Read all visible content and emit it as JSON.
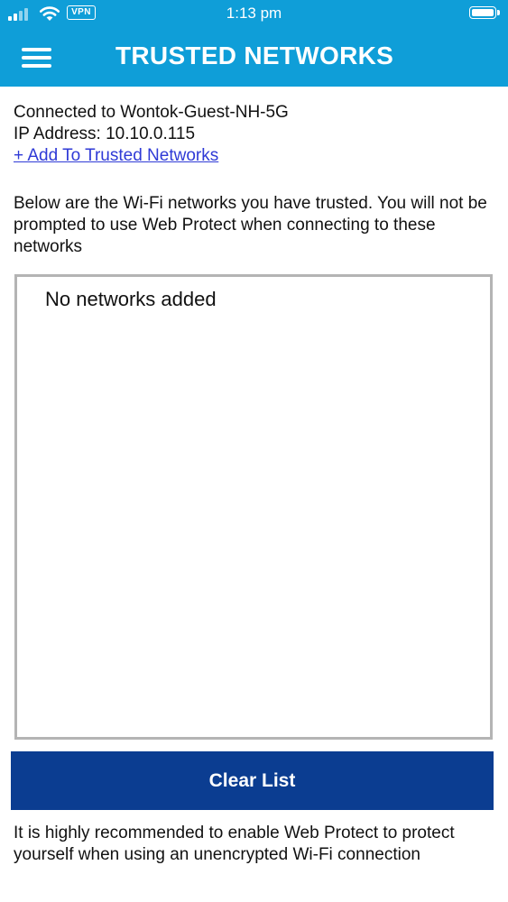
{
  "status_bar": {
    "time": "1:13 pm",
    "vpn_label": "VPN",
    "icons": [
      "signal-icon",
      "wifi-icon",
      "vpn-icon",
      "battery-icon"
    ]
  },
  "header": {
    "title": "TRUSTED NETWORKS",
    "menu_icon": "hamburger-menu-icon",
    "background_color": "#0f9ed8"
  },
  "connection": {
    "connected_text": "Connected to Wontok-Guest-NH-5G",
    "ip_text": "IP Address: 10.10.0.115",
    "add_link": "+ Add To Trusted Networks"
  },
  "description": "Below are the Wi-Fi networks you have trusted. You will not be prompted to use Web Protect when connecting to these networks",
  "networks": {
    "empty_message": "No networks added",
    "items": []
  },
  "clear_button": {
    "label": "Clear List",
    "color": "#0b3d91"
  },
  "recommendation": "It is highly recommended to enable Web Protect to protect yourself when using an unencrypted Wi-Fi connection"
}
